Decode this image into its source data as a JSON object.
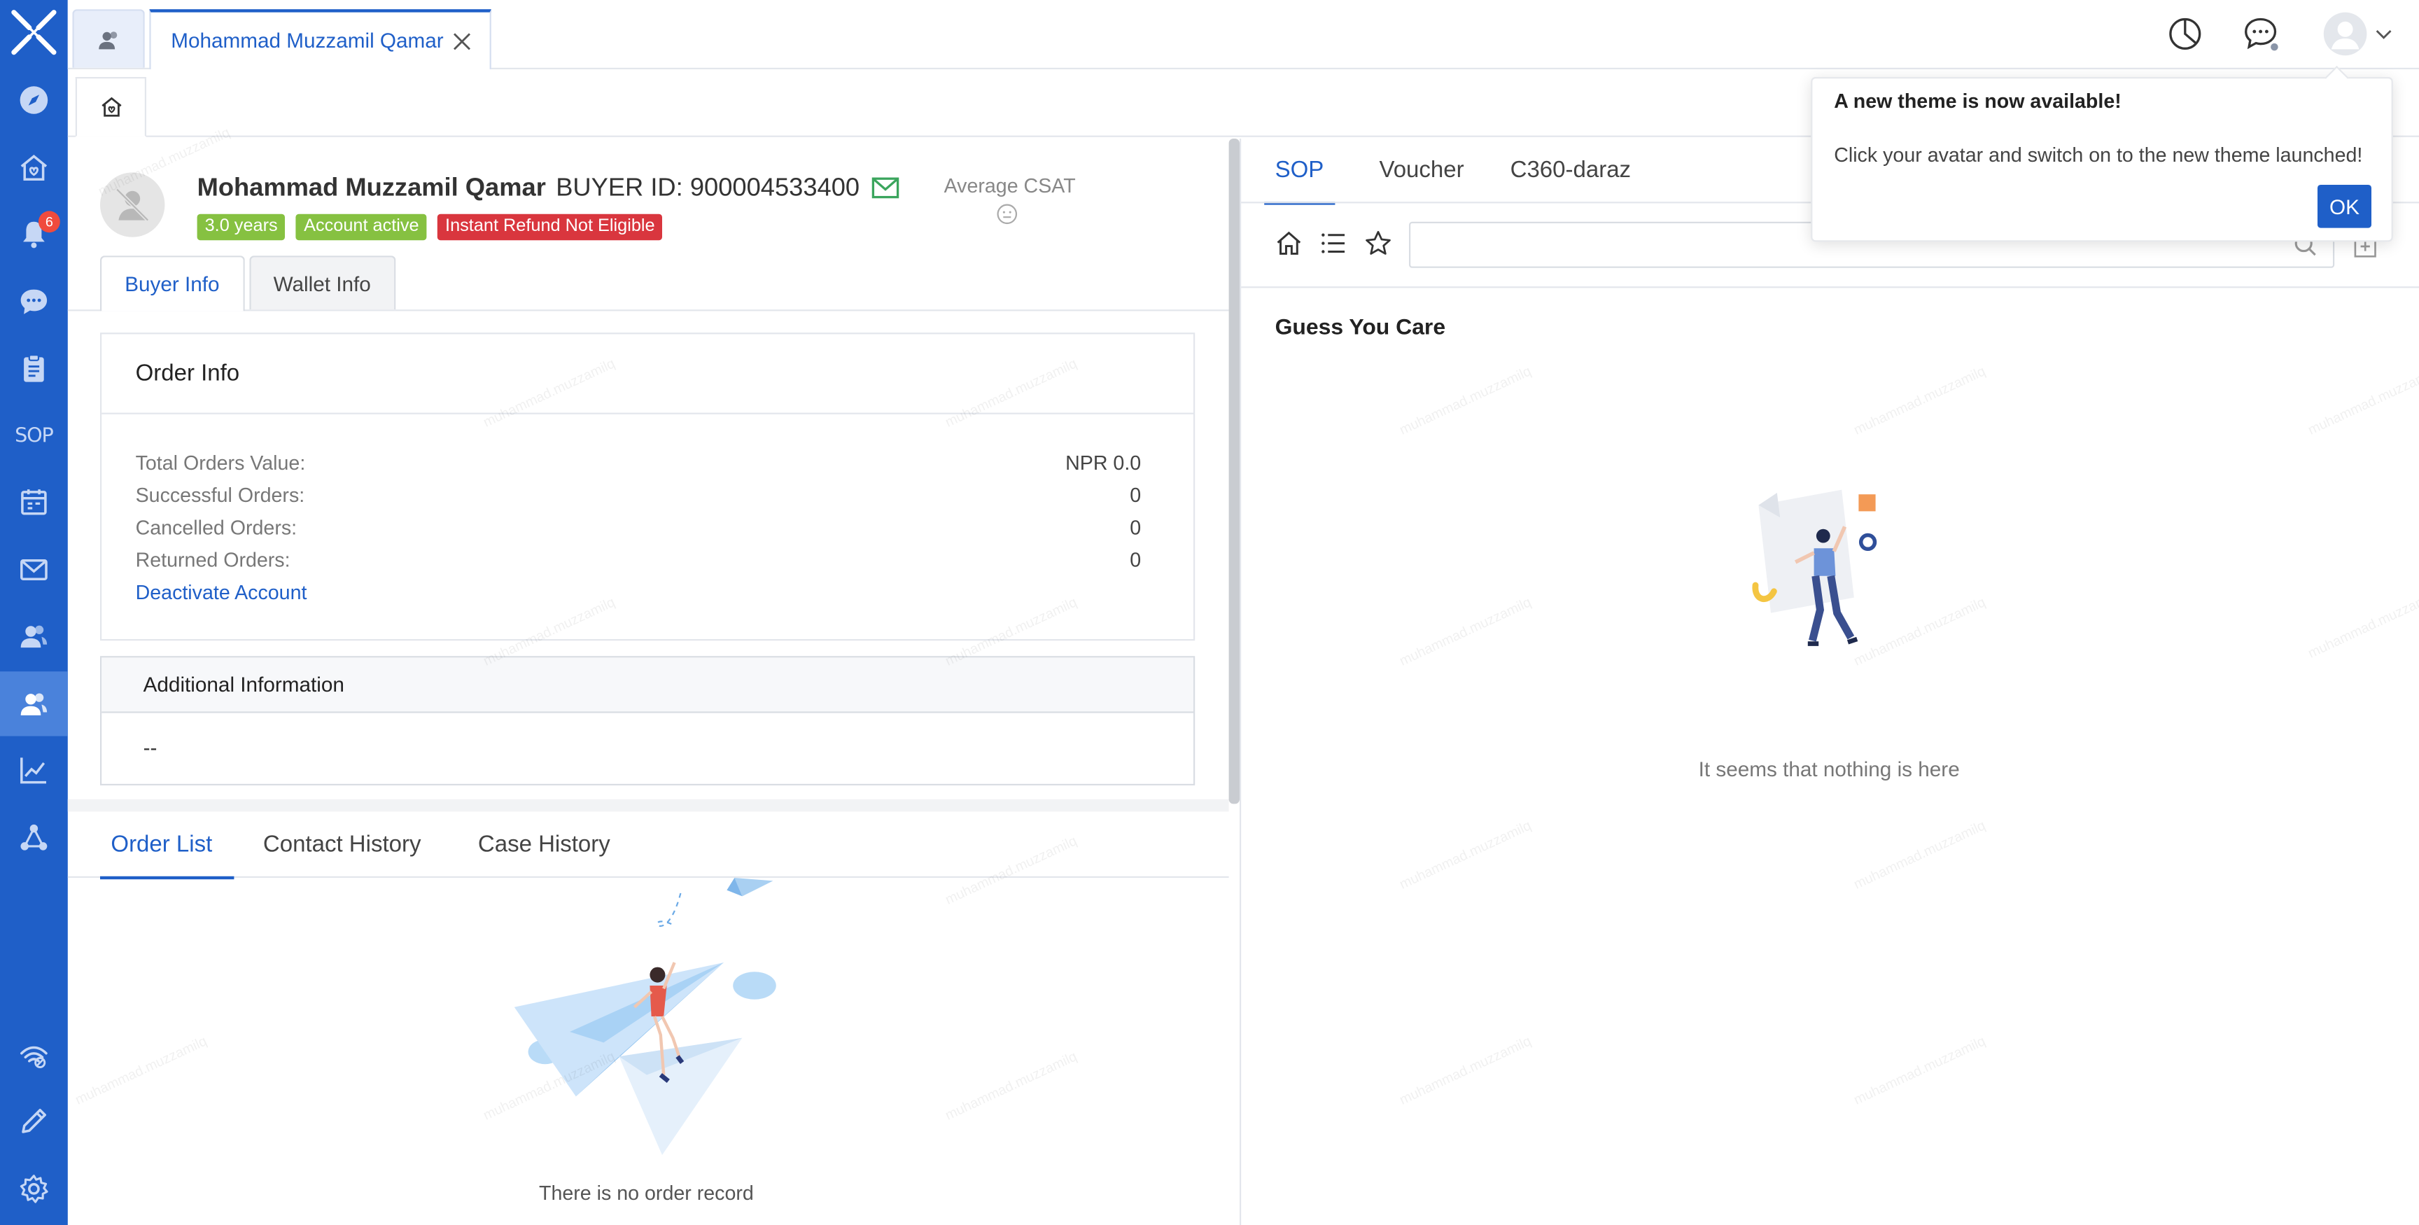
{
  "sidebar": {
    "items": [
      {
        "icon": "compass-icon"
      },
      {
        "icon": "home-heart-icon"
      },
      {
        "icon": "bell-icon",
        "badge": "6"
      },
      {
        "icon": "chat-icon"
      },
      {
        "icon": "clipboard-icon"
      },
      {
        "icon": "sop-icon",
        "label": "SOP"
      },
      {
        "icon": "calendar-icon"
      },
      {
        "icon": "mail-icon"
      },
      {
        "icon": "users-icon"
      },
      {
        "icon": "users-active-icon"
      },
      {
        "icon": "chart-line-icon"
      },
      {
        "icon": "network-icon"
      }
    ],
    "bottom_items": [
      {
        "icon": "signal-icon"
      },
      {
        "icon": "pencil-icon"
      },
      {
        "icon": "gear-icon"
      }
    ]
  },
  "topbar": {
    "open_tab_label": "Mohammad Muzzamil Qamar"
  },
  "customer": {
    "name": "Mohammad Muzzamil Qamar",
    "buyer_id": "BUYER ID: 900004533400",
    "csat_label": "Average CSAT",
    "tags": [
      "3.0 years",
      "Account active",
      "Instant Refund Not Eligible"
    ]
  },
  "info_tabs": [
    "Buyer Info",
    "Wallet Info"
  ],
  "order_info": {
    "title": "Order Info",
    "rows": [
      {
        "label": "Total Orders Value:",
        "value": "NPR 0.0"
      },
      {
        "label": "Successful Orders:",
        "value": "0"
      },
      {
        "label": "Cancelled Orders:",
        "value": "0"
      },
      {
        "label": "Returned Orders:",
        "value": "0"
      }
    ],
    "deactivate_label": "Deactivate Account"
  },
  "additional": {
    "title": "Additional Information",
    "value": "--"
  },
  "bottom_tabs": [
    "Order List",
    "Contact History",
    "Case History"
  ],
  "no_order_text": "There is no order record",
  "right_tabs": [
    "SOP",
    "Voucher",
    "C360-daraz"
  ],
  "sop": {
    "search_value": "",
    "guess_title": "Guess You Care",
    "empty_text": "It seems that nothing is here"
  },
  "popover": {
    "title": "A new theme is now available!",
    "body": "Click your avatar and switch on to the new theme launched!",
    "ok_label": "OK"
  },
  "watermark_text": "muhammad.muzzamilq",
  "colors": {
    "brand": "#1f5fc8",
    "sidebar": "#1f5fc8",
    "tag_green": "#86c141",
    "tag_red": "#d9363e",
    "badge": "#f04b3d"
  }
}
